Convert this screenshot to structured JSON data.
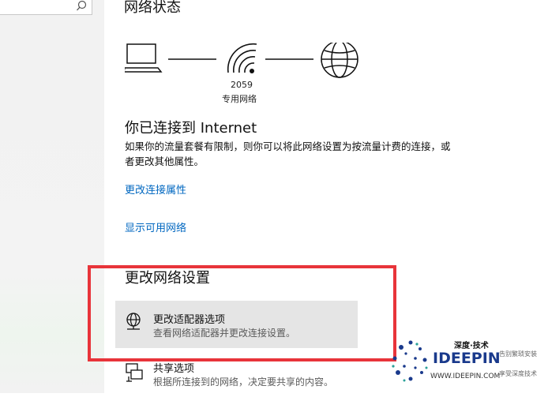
{
  "status_heading": "网络状态",
  "network": {
    "name": "2059",
    "type": "专用网络"
  },
  "connected": {
    "title": "你已连接到 Internet",
    "description": "如果你的流量套餐有限制，则你可以将此网络设置为按流量计费的连接，或者更改其他属性。"
  },
  "links": {
    "change_props": "更改连接属性",
    "show_networks": "显示可用网络"
  },
  "change_settings": {
    "title": "更改网络设置",
    "options": [
      {
        "title": "更改适配器选项",
        "subtitle": "查看网络适配器并更改连接设置。",
        "icon": "adapter-globe-icon"
      },
      {
        "title": "共享选项",
        "subtitle": "根据所连接到的网络，决定要共享的内容。",
        "icon": "sharing-icon"
      }
    ]
  },
  "watermark": {
    "cn": "深度·技术",
    "brand": "IDEEPIN",
    "url": "WWW.IDEEPIN.COM",
    "slogan1": "告别繁琐安装",
    "slogan2": "享受深度技术"
  },
  "colors": {
    "link": "#0067c0",
    "highlight": "#e5e5e5",
    "annotation_frame": "#e8343a"
  }
}
